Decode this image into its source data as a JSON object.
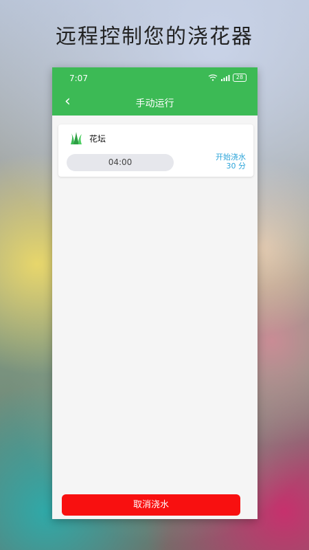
{
  "headline": "远程控制您的浇花器",
  "status_bar": {
    "time": "7:07",
    "battery": "28"
  },
  "app_bar": {
    "back_icon": "chevron-left-icon",
    "title": "手动运行"
  },
  "zone_card": {
    "icon": "grass-icon",
    "name": "花坛",
    "duration": "04:00",
    "start_label": "开始浇水",
    "minutes_label": "30 分"
  },
  "footer": {
    "cancel_label": "取消浇水"
  },
  "colors": {
    "primary": "#3cba55",
    "accent_blue": "#2ba4d9",
    "danger": "#f81010"
  }
}
